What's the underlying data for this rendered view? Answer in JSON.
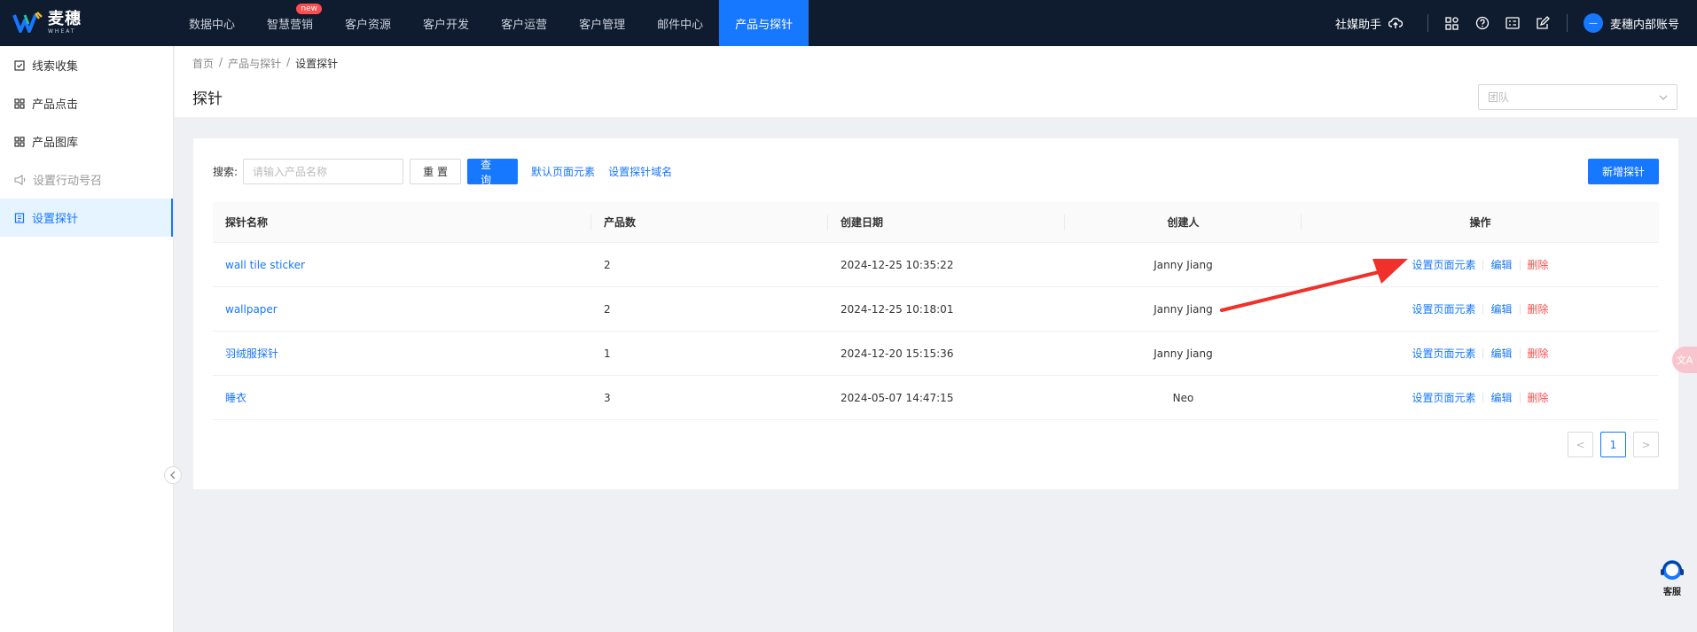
{
  "logo": {
    "name_cn": "麦穗",
    "name_en": "WHEAT"
  },
  "nav": {
    "items": [
      {
        "label": "数据中心",
        "active": false
      },
      {
        "label": "智慧营销",
        "active": false,
        "badge": "new"
      },
      {
        "label": "客户资源",
        "active": false
      },
      {
        "label": "客户开发",
        "active": false
      },
      {
        "label": "客户运营",
        "active": false
      },
      {
        "label": "客户管理",
        "active": false
      },
      {
        "label": "邮件中心",
        "active": false
      },
      {
        "label": "产品与探针",
        "active": true
      }
    ],
    "social_label": "社媒助手",
    "account_name": "麦穗内部账号",
    "tool_icons": [
      "grid-icon",
      "help-icon",
      "id-card-icon",
      "edit-icon"
    ]
  },
  "sidebar": {
    "items": [
      {
        "label": "线索收集",
        "icon": "checkbox-icon",
        "state": "normal"
      },
      {
        "label": "产品点击",
        "icon": "grid-icon",
        "state": "normal"
      },
      {
        "label": "产品图库",
        "icon": "grid-icon",
        "state": "normal"
      },
      {
        "label": "设置行动号召",
        "icon": "megaphone-icon",
        "state": "disabled"
      },
      {
        "label": "设置探针",
        "icon": "doc-icon",
        "state": "active"
      }
    ]
  },
  "header": {
    "breadcrumb": [
      "首页",
      "产品与探针",
      "设置探针"
    ],
    "title": "探针",
    "team_placeholder": "团队"
  },
  "toolbar": {
    "search_label": "搜索:",
    "search_placeholder": "请输入产品名称",
    "search_value": "",
    "reset_label": "重 置",
    "query_label": "查 询",
    "default_elements_link": "默认页面元素",
    "domain_link": "设置探针域名",
    "add_label": "新增探针"
  },
  "table": {
    "columns": [
      "探针名称",
      "产品数",
      "创建日期",
      "创建人",
      "操作"
    ],
    "rows": [
      {
        "name": "wall tile sticker",
        "count": "2",
        "date": "2024-12-25 10:35:22",
        "creator": "Janny Jiang"
      },
      {
        "name": "wallpaper",
        "count": "2",
        "date": "2024-12-25 10:18:01",
        "creator": "Janny Jiang"
      },
      {
        "name": "羽绒服探针",
        "count": "1",
        "date": "2024-12-20 15:15:36",
        "creator": "Janny Jiang"
      },
      {
        "name": "睡衣",
        "count": "3",
        "date": "2024-05-07 14:47:15",
        "creator": "Neo"
      }
    ],
    "actions": {
      "set_elements": "设置页面元素",
      "edit": "编辑",
      "delete": "删除"
    }
  },
  "pagination": {
    "prev": "<",
    "current": "1",
    "next": ">"
  },
  "float_tab": "文A",
  "support_label": "客服",
  "colors": {
    "primary": "#1677ff",
    "danger": "#ff4d4f",
    "topbar": "#0f1b2e",
    "annotation_arrow": "#f0302a"
  }
}
